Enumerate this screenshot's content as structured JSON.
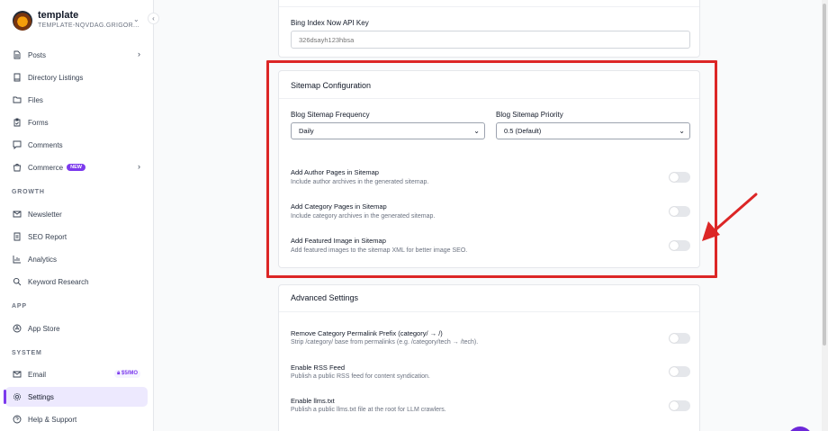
{
  "sidebar": {
    "brand_name": "template",
    "brand_sub": "TEMPLATE-NQVDAG.GRIGOR...",
    "items": [
      {
        "label": "Posts",
        "icon": "file-text-icon"
      },
      {
        "label": "Directory Listings",
        "icon": "book-icon"
      },
      {
        "label": "Files",
        "icon": "folder-icon"
      },
      {
        "label": "Forms",
        "icon": "clipboard-icon"
      },
      {
        "label": "Comments",
        "icon": "message-icon"
      },
      {
        "label": "Commerce",
        "icon": "shopping-bag-icon",
        "badge": "NEW"
      },
      {
        "label": "Newsletter",
        "icon": "mail-icon"
      },
      {
        "label": "SEO Report",
        "icon": "report-icon"
      },
      {
        "label": "Analytics",
        "icon": "bar-chart-icon"
      },
      {
        "label": "Keyword Research",
        "icon": "search-icon"
      },
      {
        "label": "App Store",
        "icon": "app-store-icon"
      },
      {
        "label": "Email",
        "icon": "mail-icon",
        "badge": "$5/MO"
      },
      {
        "label": "Settings",
        "icon": "gear-icon"
      },
      {
        "label": "Help & Support",
        "icon": "help-icon"
      }
    ],
    "sections": {
      "growth": "GROWTH",
      "app": "APP",
      "system": "SYSTEM"
    }
  },
  "bing": {
    "label": "Bing Index Now API Key",
    "value": "326dsayh123hbsa"
  },
  "sitemap": {
    "title": "Sitemap Configuration",
    "frequency_label": "Blog Sitemap Frequency",
    "frequency_value": "Daily",
    "priority_label": "Blog Sitemap Priority",
    "priority_value": "0.5 (Default)",
    "toggles": [
      {
        "title": "Add Author Pages in Sitemap",
        "desc": "Include author archives in the generated sitemap."
      },
      {
        "title": "Add Category Pages in Sitemap",
        "desc": "Include category archives in the generated sitemap."
      },
      {
        "title": "Add Featured Image in Sitemap",
        "desc": "Add featured images to the sitemap XML for better image SEO."
      }
    ]
  },
  "advanced": {
    "title": "Advanced Settings",
    "toggles": [
      {
        "title": "Remove Category Permalink Prefix (category/ → /)",
        "desc": "Strip /category/ base from permalinks (e.g. /category/tech → /tech)."
      },
      {
        "title": "Enable RSS Feed",
        "desc": "Publish a public RSS feed for content syndication."
      },
      {
        "title": "Enable llms.txt",
        "desc": "Publish a public llms.txt file at the root for LLM crawlers."
      }
    ]
  },
  "colors": {
    "accent": "#7c3aed",
    "annotation": "#dc2626"
  }
}
